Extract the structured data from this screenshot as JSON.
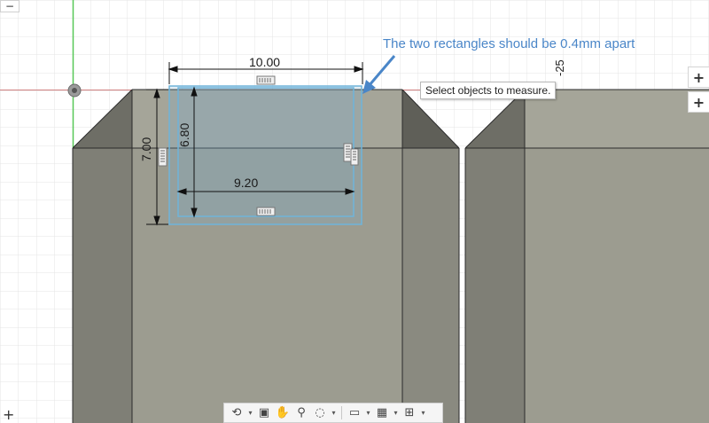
{
  "annotation": {
    "text": "The two rectangles should be 0.4mm apart",
    "color": "#4a86c8"
  },
  "tooltip": {
    "text": "Select objects to measure."
  },
  "dimensions": {
    "width_outer": "10.00",
    "width_inner": "9.20",
    "height_outer": "7.00",
    "height_inner": "6.80",
    "axis_label": "-25"
  },
  "view_controls": {
    "plus_top": "+",
    "plus_second": "+",
    "minus_corner": "−",
    "plus_bottom_left": "+"
  },
  "navbar": {
    "items": [
      {
        "name": "orbit",
        "icon": "⟲"
      },
      {
        "name": "look-at",
        "icon": "▣"
      },
      {
        "name": "pan",
        "icon": "✋"
      },
      {
        "name": "zoom",
        "icon": "⚲"
      },
      {
        "name": "fit",
        "icon": "◌"
      },
      {
        "name": "display-settings",
        "icon": "▭"
      },
      {
        "name": "grid-settings",
        "icon": "▦"
      },
      {
        "name": "viewports",
        "icon": "⊞"
      }
    ],
    "caret": "▾"
  },
  "colors": {
    "grid": "#e6e6e6",
    "model_face": "#a0a094",
    "model_dark": "#7a7a70",
    "selection": "#6fb4da",
    "accent": "#4a86c8"
  }
}
